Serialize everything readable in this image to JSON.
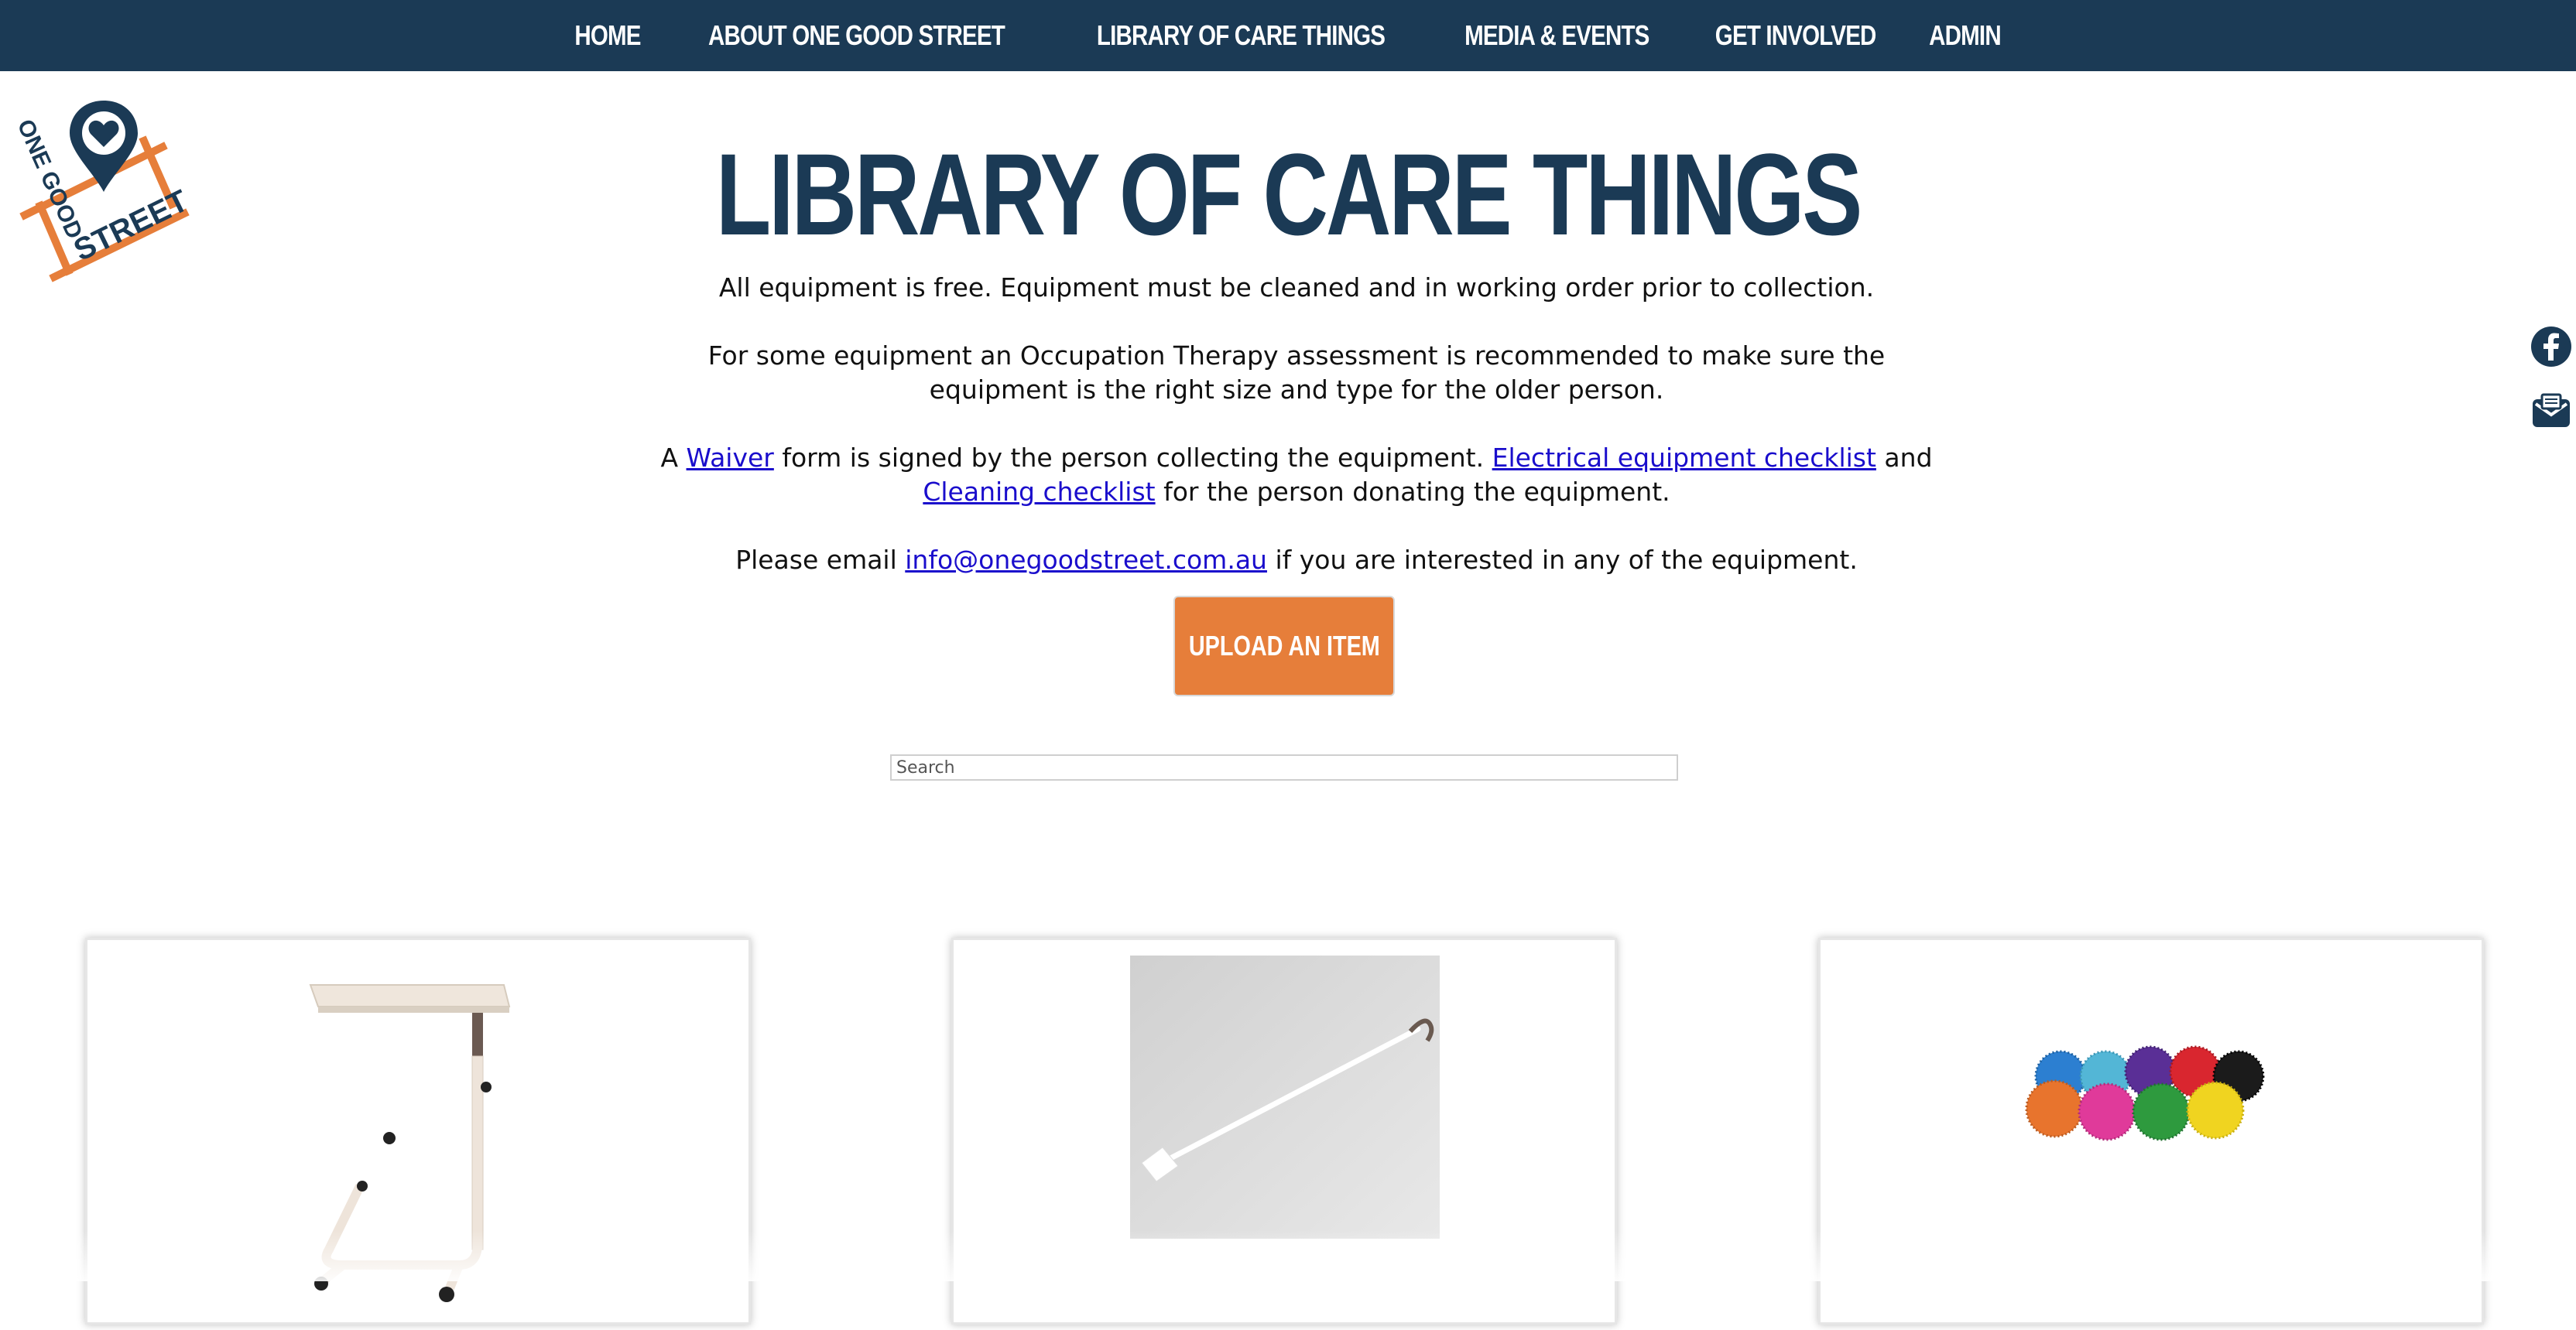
{
  "nav": {
    "items": [
      {
        "label": "HOME"
      },
      {
        "label": "ABOUT ONE GOOD STREET"
      },
      {
        "label": "LIBRARY OF CARE THINGS"
      },
      {
        "label": "MEDIA & EVENTS"
      },
      {
        "label": "GET INVOLVED"
      },
      {
        "label": "ADMIN"
      }
    ]
  },
  "logo": {
    "text_line1": "ONE GOOD",
    "text_line2": "STREET"
  },
  "page": {
    "title": "LIBRARY OF CARE THINGS",
    "para1": "All equipment is free. Equipment must be cleaned and in working order prior to collection.",
    "para2": "For some equipment an Occupation Therapy assessment is recommended to make sure the equipment is the right size and type for the older person.",
    "para3": {
      "pre": "A ",
      "waiver_link": "Waiver",
      "mid1": " form is signed by the person collecting the equipment. ",
      "electrical_link": "Electrical equipment checklist",
      "mid2": " and ",
      "cleaning_link": "Cleaning checklist",
      "post": " for the person donating the equipment."
    },
    "para4": {
      "pre": "Please email ",
      "email_link": "info@onegoodstreet.com.au",
      "post": " if you are interested in any of the equipment."
    },
    "upload_button": "UPLOAD AN ITEM",
    "search_placeholder": "Search"
  },
  "side_icons": [
    "facebook-icon",
    "email-icon"
  ],
  "colors": {
    "navy": "#1b3a55",
    "orange": "#e67e3a",
    "link": "#1a0dcc"
  }
}
